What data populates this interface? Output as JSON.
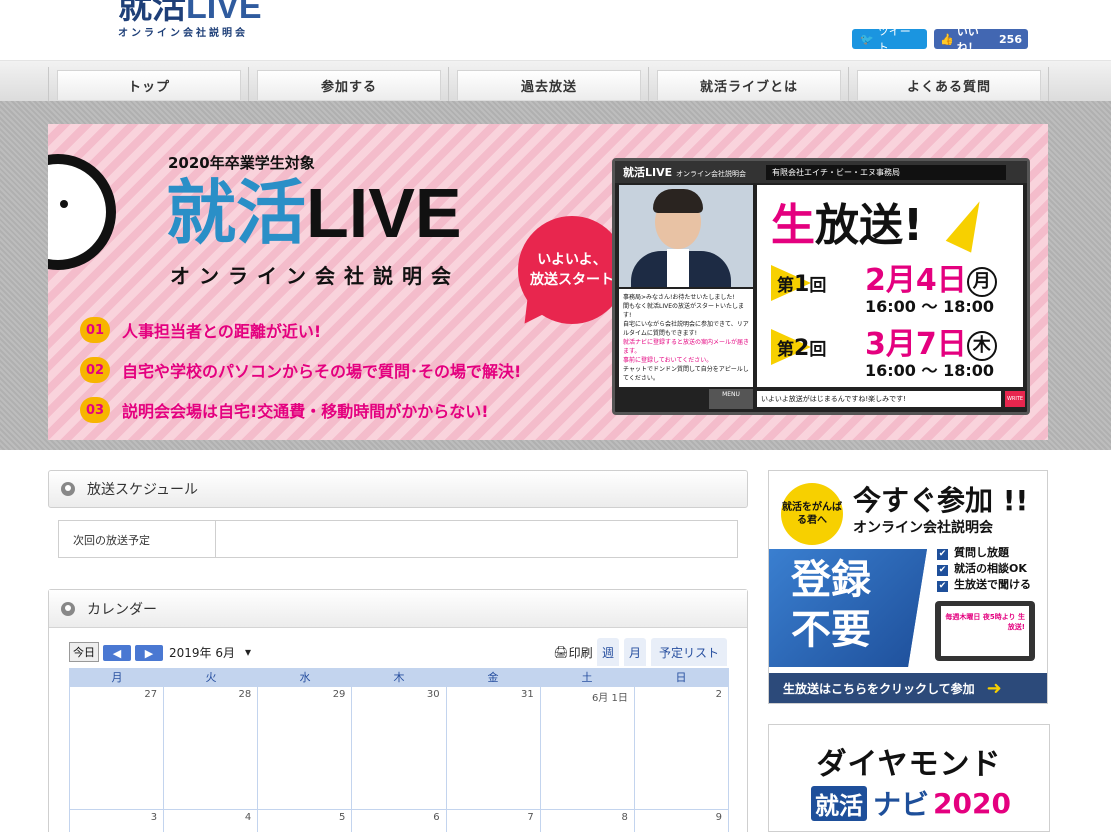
{
  "header": {
    "logo_main": "就活",
    "logo_live": "LIVE",
    "logo_sub": "オンライン会社説明会",
    "tweet_label": "ツイート",
    "like_label": "いいね！",
    "like_count": "256"
  },
  "nav": {
    "items": [
      {
        "label": "トップ"
      },
      {
        "label": "参加する"
      },
      {
        "label": "過去放送"
      },
      {
        "label": "就活ライブとは"
      },
      {
        "label": "よくある質問"
      }
    ]
  },
  "hero": {
    "target": "2020年卒業学生対象",
    "title_kanji": "就活",
    "title_live": "LIVE",
    "subtitle": "オンライン会社説明会",
    "bubble_line1": "いよいよ、",
    "bubble_line2": "放送スタート",
    "points": [
      {
        "num": "01",
        "text": "人事担当者との距離が近い!"
      },
      {
        "num": "02",
        "text": "自宅や学校のパソコンからその場で質問･その場で解決!"
      },
      {
        "num": "03",
        "text": "説明会会場は自宅!交通費・移動時間がかからない!"
      }
    ],
    "player": {
      "title": "就活LIVE",
      "title_sub": "オンライン会社説明会",
      "company": "有限会社エイチ・ビー・エヌ事務局",
      "live_sei": "生",
      "live_rest": "放送!",
      "round1_label": "第",
      "round1_num": "1",
      "round1_suffix": "回",
      "round1_date": "2月4日",
      "round1_dow": "月",
      "round1_time": "16:00 ～ 18:00",
      "round2_label": "第",
      "round2_num": "2",
      "round2_suffix": "回",
      "round2_date": "3月7日",
      "round2_dow": "木",
      "round2_time": "16:00 ～ 18:00",
      "chat_line1": "事務局>みなさん!お待たせいたしました!",
      "chat_line2": "間もなく就活LIVEの放送がスタートいたします!",
      "chat_line3": "自宅にいながら会社説明会に参加できて、リアルタイムに質問もできます!",
      "chat_line4": "就活ナビに登録すると放送の案内メールが届きます。",
      "chat_line5": "事前に登録しておいてください。",
      "chat_line6": "チャットでドンドン質問して自分をアピールしてください。",
      "input_text": "いよいよ放送がはじまるんですね!楽しみです!",
      "write_label": "WRITE",
      "menu_label": "MENU"
    }
  },
  "schedule": {
    "heading": "放送スケジュール",
    "next_label": "次回の放送予定",
    "next_value": ""
  },
  "calendar": {
    "heading": "カレンダー",
    "today_label": "今日",
    "prev_label": "◀",
    "next_label": "▶",
    "month_label": "2019年 6月",
    "print_label": "印刷",
    "tabs": [
      {
        "label": "週"
      },
      {
        "label": "月"
      },
      {
        "label": "予定リスト"
      }
    ],
    "dows": [
      "月",
      "火",
      "水",
      "木",
      "金",
      "土",
      "日"
    ],
    "week1": [
      "27",
      "28",
      "29",
      "30",
      "31",
      "6月 1日",
      "2"
    ],
    "week2": [
      "3",
      "4",
      "5",
      "6",
      "7",
      "8",
      "9"
    ]
  },
  "ad1": {
    "badge": "就活をがんばる君へ",
    "title": "今すぐ参加 !!",
    "sub": "オンライン会社説明会",
    "big_line1": "登録",
    "big_line2": "不要",
    "checks": [
      "質問し放題",
      "就活の相談OK",
      "生放送で聞ける"
    ],
    "laptop_text": "毎週木曜日 夜5時より 生放送!",
    "footer": "生放送はこちらをクリックして参加",
    "arrow": "➜"
  },
  "ad2": {
    "title": "ダイヤモンド",
    "badge": "就活",
    "navi": "ナビ",
    "year": "2020"
  }
}
